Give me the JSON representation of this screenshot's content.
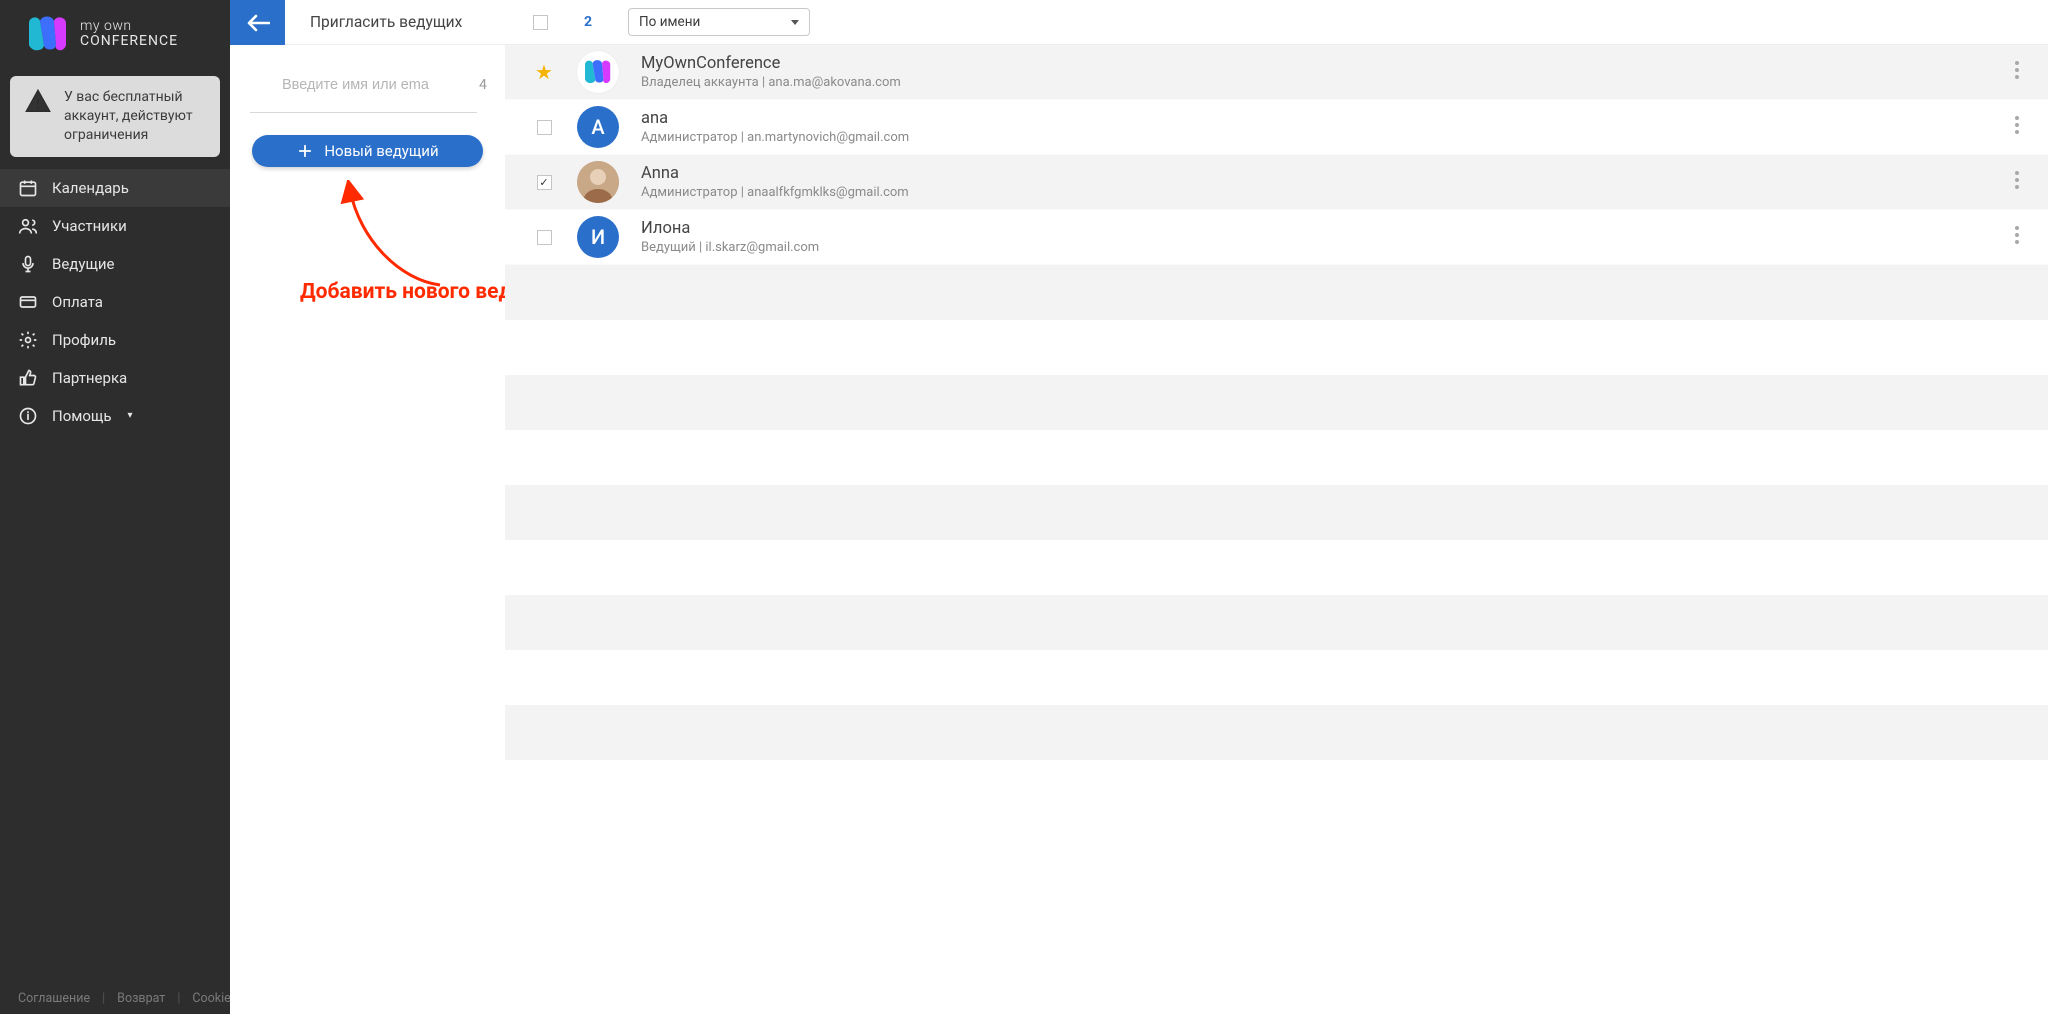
{
  "brand": {
    "line1": "my own",
    "line2": "CONFERENCE"
  },
  "account_warning": "У вас бесплатный аккаунт, действуют ограничения",
  "sidebar": {
    "items": [
      {
        "label": "Календарь",
        "icon": "calendar",
        "active": true
      },
      {
        "label": "Участники",
        "icon": "users"
      },
      {
        "label": "Ведущие",
        "icon": "mic"
      },
      {
        "label": "Оплата",
        "icon": "card"
      },
      {
        "label": "Профиль",
        "icon": "gear"
      },
      {
        "label": "Партнерка",
        "icon": "thumbs"
      },
      {
        "label": "Помощь",
        "icon": "info",
        "dropdown": true
      }
    ]
  },
  "footer": {
    "agreement": "Соглашение",
    "refund": "Возврат",
    "cookies": "Cookies"
  },
  "mid": {
    "title": "Пригласить ведущих",
    "search_placeholder": "Введите имя или ema",
    "count": "4",
    "new_host_label": "Новый ведущий"
  },
  "annotation_text": "Добавить нового ведущего",
  "list_header": {
    "count": "2",
    "sort_selected": "По имени"
  },
  "hosts": [
    {
      "name": "MyOwnConference",
      "meta": "Владелец аккаунта | ana.ma@akovana.com",
      "avatar": "logo",
      "star": true,
      "checked": false
    },
    {
      "name": "ana",
      "meta": "Администратор | an.martynovich@gmail.com",
      "avatar": "blue",
      "initial": "A",
      "checked": false
    },
    {
      "name": "Anna",
      "meta": "Администратор | anaalfkfgmklks@gmail.com",
      "avatar": "photo",
      "checked": true
    },
    {
      "name": "Илона",
      "meta": "Ведущий | il.skarz@gmail.com",
      "avatar": "blue",
      "initial": "И",
      "checked": false
    }
  ]
}
